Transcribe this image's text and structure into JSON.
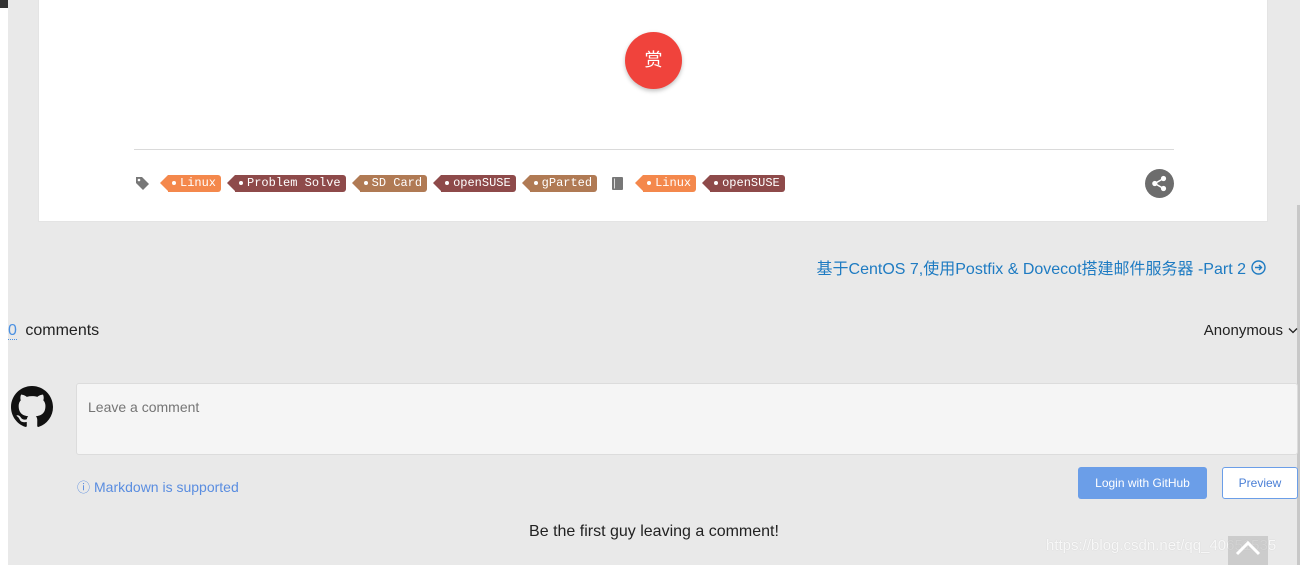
{
  "article": {
    "reward_label": "赏",
    "tags": [
      {
        "label": "Linux",
        "color": "#f4884c"
      },
      {
        "label": "Problem Solve",
        "color": "#8e4a4a"
      },
      {
        "label": "SD Card",
        "color": "#b07a54"
      },
      {
        "label": "openSUSE",
        "color": "#8e4a4a"
      },
      {
        "label": "gParted",
        "color": "#b07a54"
      }
    ],
    "categories": [
      {
        "label": "Linux",
        "color": "#f4884c"
      },
      {
        "label": "openSUSE",
        "color": "#8e4a4a"
      }
    ],
    "tag_icon": "tag-icon",
    "category_icon": "book-icon",
    "share_icon": "share-icon"
  },
  "navigation": {
    "next_post": "基于CentOS 7,使用Postfix & Dovecot搭建邮件服务器 -Part 2"
  },
  "comments": {
    "count": "0",
    "count_label": "comments",
    "user": "Anonymous",
    "placeholder": "Leave a comment",
    "markdown_note": "Markdown is supported",
    "login_button": "Login with GitHub",
    "preview_button": "Preview",
    "empty_message": "Be the first guy leaving a comment!"
  },
  "watermark": "https://blog.csdn.net/qq_40651535",
  "colors": {
    "reward": "#f0433c",
    "link": "#1e7bc2",
    "button": "#6b9ee8"
  }
}
